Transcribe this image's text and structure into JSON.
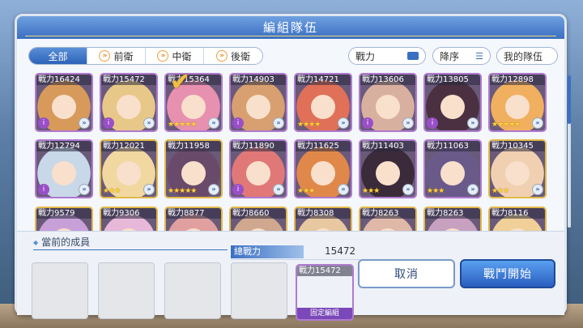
{
  "title": "編組隊伍",
  "filter_tabs": [
    {
      "label": "全部",
      "icon": ""
    },
    {
      "label": "前衛",
      "icon": "chevron-icon"
    },
    {
      "label": "中衛",
      "icon": "chevron-icon"
    },
    {
      "label": "後衛",
      "icon": "chevron-icon"
    }
  ],
  "sort": {
    "stat_label": "戰力",
    "order_label": "降序",
    "my_team_label": "我的隊伍"
  },
  "cards": [
    {
      "power": "戰力16424",
      "hue": "#d89a5a",
      "badge": "i",
      "frame": "purple"
    },
    {
      "power": "戰力15472",
      "hue": "#e8c888",
      "badge": "i",
      "frame": "purple"
    },
    {
      "power": "戰力15364",
      "hue": "#e890b0",
      "badge": "★★★★★",
      "frame": "purple"
    },
    {
      "power": "戰力14903",
      "hue": "#d8a070",
      "badge": "i",
      "frame": "purple"
    },
    {
      "power": "戰力14721",
      "hue": "#e07058",
      "badge": "★★★★",
      "frame": "purple"
    },
    {
      "power": "戰力13606",
      "hue": "#d8b0a0",
      "badge": "i",
      "frame": "purple"
    },
    {
      "power": "戰力13805",
      "hue": "#4a3040",
      "badge": "i",
      "frame": "purple"
    },
    {
      "power": "戰力12898",
      "hue": "#f0b060",
      "badge": "★★★★★",
      "frame": "purple"
    },
    {
      "power": "戰力12794",
      "hue": "#c8d8e8",
      "badge": "i",
      "frame": "purple"
    },
    {
      "power": "戰力12021",
      "hue": "#f0d8a0",
      "badge": "★★★",
      "frame": "gold"
    },
    {
      "power": "戰力11958",
      "hue": "#6a4a6a",
      "badge": "★★★★★",
      "frame": "gold"
    },
    {
      "power": "戰力11890",
      "hue": "#e07878",
      "badge": "i",
      "frame": "purple"
    },
    {
      "power": "戰力11625",
      "hue": "#e0884a",
      "badge": "★★★",
      "frame": "purple"
    },
    {
      "power": "戰力11403",
      "hue": "#3a2a3a",
      "badge": "★★★",
      "frame": "purple"
    },
    {
      "power": "戰力11063",
      "hue": "#6a5a8a",
      "badge": "★★★",
      "frame": "purple"
    },
    {
      "power": "戰力10345",
      "hue": "#f0d0b0",
      "badge": "★★★",
      "frame": "gold"
    },
    {
      "power": "戰力9579",
      "hue": "#c8a0d8",
      "badge": "",
      "frame": "gold"
    },
    {
      "power": "戰力9306",
      "hue": "#e8b8d8",
      "badge": "",
      "frame": "gold"
    },
    {
      "power": "戰力8877",
      "hue": "#e0a0a0",
      "badge": "",
      "frame": "gold"
    },
    {
      "power": "戰力8660",
      "hue": "#d0a890",
      "badge": "",
      "frame": "gold"
    },
    {
      "power": "戰力8308",
      "hue": "#e8c8a0",
      "badge": "",
      "frame": "gold"
    },
    {
      "power": "戰力8263",
      "hue": "#e0b8a8",
      "badge": "",
      "frame": "gold"
    },
    {
      "power": "戰力8263",
      "hue": "#c8a0c0",
      "badge": "",
      "frame": "gold"
    },
    {
      "power": "戰力8116",
      "hue": "#f0d098",
      "badge": "",
      "frame": "gold"
    }
  ],
  "members_label": "當前的成員",
  "total_power_label": "總戰力",
  "total_power_value": "15472",
  "support": {
    "power": "戰力15472",
    "tag": "固定編組"
  },
  "buttons": {
    "cancel": "取消",
    "start": "戰鬥開始"
  },
  "colors": {
    "accent": "#3a6fc2",
    "title_bar": "#4a80d0",
    "rarity_purple": "#b07ad0",
    "rarity_gold": "#e2b84a"
  }
}
